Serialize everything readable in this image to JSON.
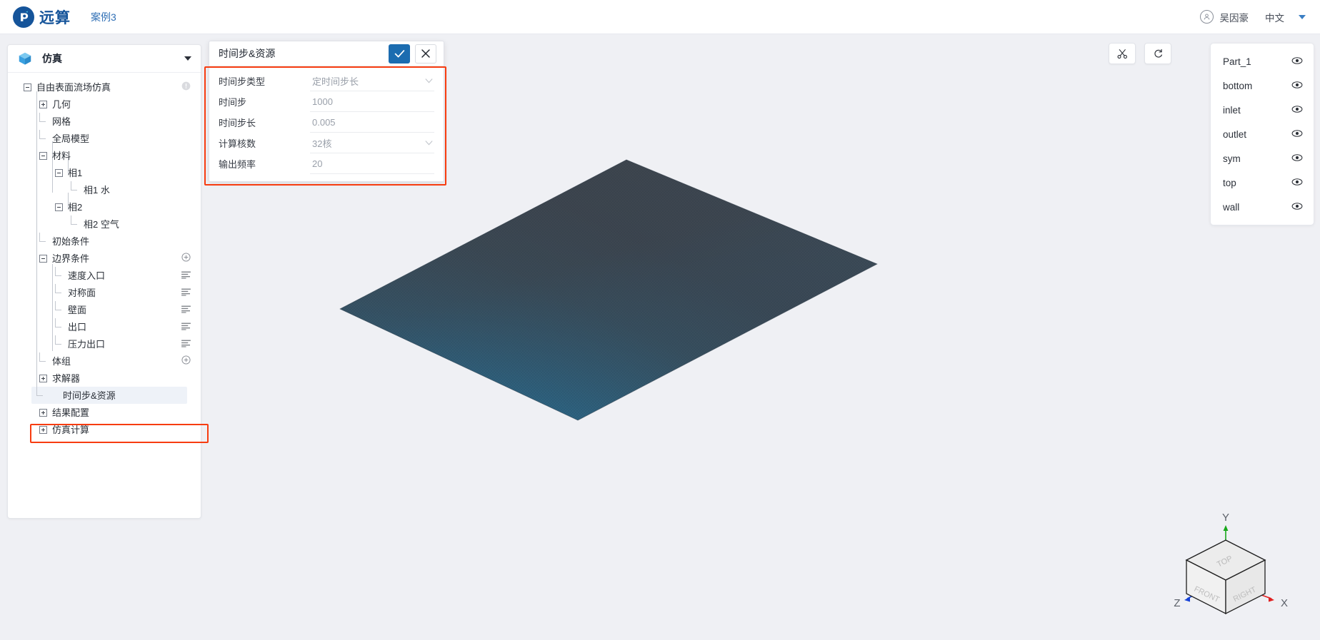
{
  "header": {
    "brand_name": "远算",
    "case_title": "案例3",
    "user_name": "吴因豪",
    "language": "中文",
    "logo_icon": "logo-mark-icon",
    "avatar_icon": "user-avatar-icon",
    "caret_icon": "chevron-down-icon"
  },
  "sidebar": {
    "panel_title": "仿真",
    "panel_icon": "cube-icon",
    "collapse_icon": "chevron-down-icon",
    "tree": [
      {
        "label": "自由表面流场仿真",
        "indent": 0,
        "toggle": "minus",
        "icon": "info-icon"
      },
      {
        "label": "几何",
        "indent": 1,
        "toggle": "plus",
        "icon": ""
      },
      {
        "label": "网格",
        "indent": 1,
        "toggle": "leaf",
        "icon": ""
      },
      {
        "label": "全局模型",
        "indent": 1,
        "toggle": "leaf",
        "icon": ""
      },
      {
        "label": "材料",
        "indent": 1,
        "toggle": "minus",
        "icon": ""
      },
      {
        "label": "相1",
        "indent": 2,
        "toggle": "minus",
        "icon": ""
      },
      {
        "label": "相1 水",
        "indent": 3,
        "toggle": "leaf",
        "icon": ""
      },
      {
        "label": "相2",
        "indent": 2,
        "toggle": "minus",
        "icon": ""
      },
      {
        "label": "相2 空气",
        "indent": 3,
        "toggle": "leaf",
        "icon": ""
      },
      {
        "label": "初始条件",
        "indent": 1,
        "toggle": "leaf",
        "icon": ""
      },
      {
        "label": "边界条件",
        "indent": 1,
        "toggle": "minus",
        "icon": "plus-circle-icon"
      },
      {
        "label": "速度入口",
        "indent": 2,
        "toggle": "leaf",
        "icon": "list-icon"
      },
      {
        "label": "对称面",
        "indent": 2,
        "toggle": "leaf",
        "icon": "list-icon"
      },
      {
        "label": "壁面",
        "indent": 2,
        "toggle": "leaf",
        "icon": "list-icon"
      },
      {
        "label": "出口",
        "indent": 2,
        "toggle": "leaf",
        "icon": "list-icon"
      },
      {
        "label": "压力出口",
        "indent": 2,
        "toggle": "leaf",
        "icon": "list-icon"
      },
      {
        "label": "体组",
        "indent": 1,
        "toggle": "leaf",
        "icon": "plus-circle-icon"
      },
      {
        "label": "求解器",
        "indent": 1,
        "toggle": "plus",
        "icon": ""
      },
      {
        "label": "时间步&资源",
        "indent": 1,
        "toggle": "leaf",
        "icon": "",
        "selected": true
      },
      {
        "label": "结果配置",
        "indent": 1,
        "toggle": "plus",
        "icon": ""
      },
      {
        "label": "仿真计算",
        "indent": 1,
        "toggle": "plus",
        "icon": ""
      }
    ]
  },
  "dialog": {
    "title": "时间步&资源",
    "confirm_icon": "check-icon",
    "close_icon": "close-icon",
    "fields": [
      {
        "label": "时间步类型",
        "value": "定时间步长",
        "type": "select",
        "icon": "chevron-down-icon"
      },
      {
        "label": "时间步",
        "value": "1000",
        "type": "text",
        "icon": ""
      },
      {
        "label": "时间步长",
        "value": "0.005",
        "type": "text",
        "icon": ""
      },
      {
        "label": "计算核数",
        "value": "32核",
        "type": "select",
        "icon": "chevron-down-icon"
      },
      {
        "label": "输出频率",
        "value": "20",
        "type": "text",
        "icon": ""
      }
    ]
  },
  "canvas": {
    "toolbar": [
      {
        "name": "clip-scissors-button",
        "icon": "scissors-icon"
      },
      {
        "name": "reset-view-button",
        "icon": "rotate-reset-icon"
      }
    ],
    "parts": [
      {
        "label": "Part_1",
        "icon": "eye-icon"
      },
      {
        "label": "bottom",
        "icon": "eye-icon"
      },
      {
        "label": "inlet",
        "icon": "eye-icon"
      },
      {
        "label": "outlet",
        "icon": "eye-icon"
      },
      {
        "label": "sym",
        "icon": "eye-icon"
      },
      {
        "label": "top",
        "icon": "eye-icon"
      },
      {
        "label": "wall",
        "icon": "eye-icon"
      }
    ],
    "axis_cube": {
      "faces": [
        "TOP",
        "FRONT",
        "RIGHT"
      ],
      "axes": [
        {
          "label": "Y",
          "color": "#17a81a"
        },
        {
          "label": "X",
          "color": "#e02020"
        },
        {
          "label": "Z",
          "color": "#1642d8"
        }
      ]
    },
    "model": {
      "description": "mesh-plate",
      "color_start": "#2d6381",
      "color_end": "#3e424a"
    }
  },
  "colors": {
    "accent": "#1b6cb0",
    "brand": "#15549a",
    "highlight_outline": "#f73c10",
    "canvas_bg": "#eff0f4",
    "selected_row": "#eef2f8"
  }
}
